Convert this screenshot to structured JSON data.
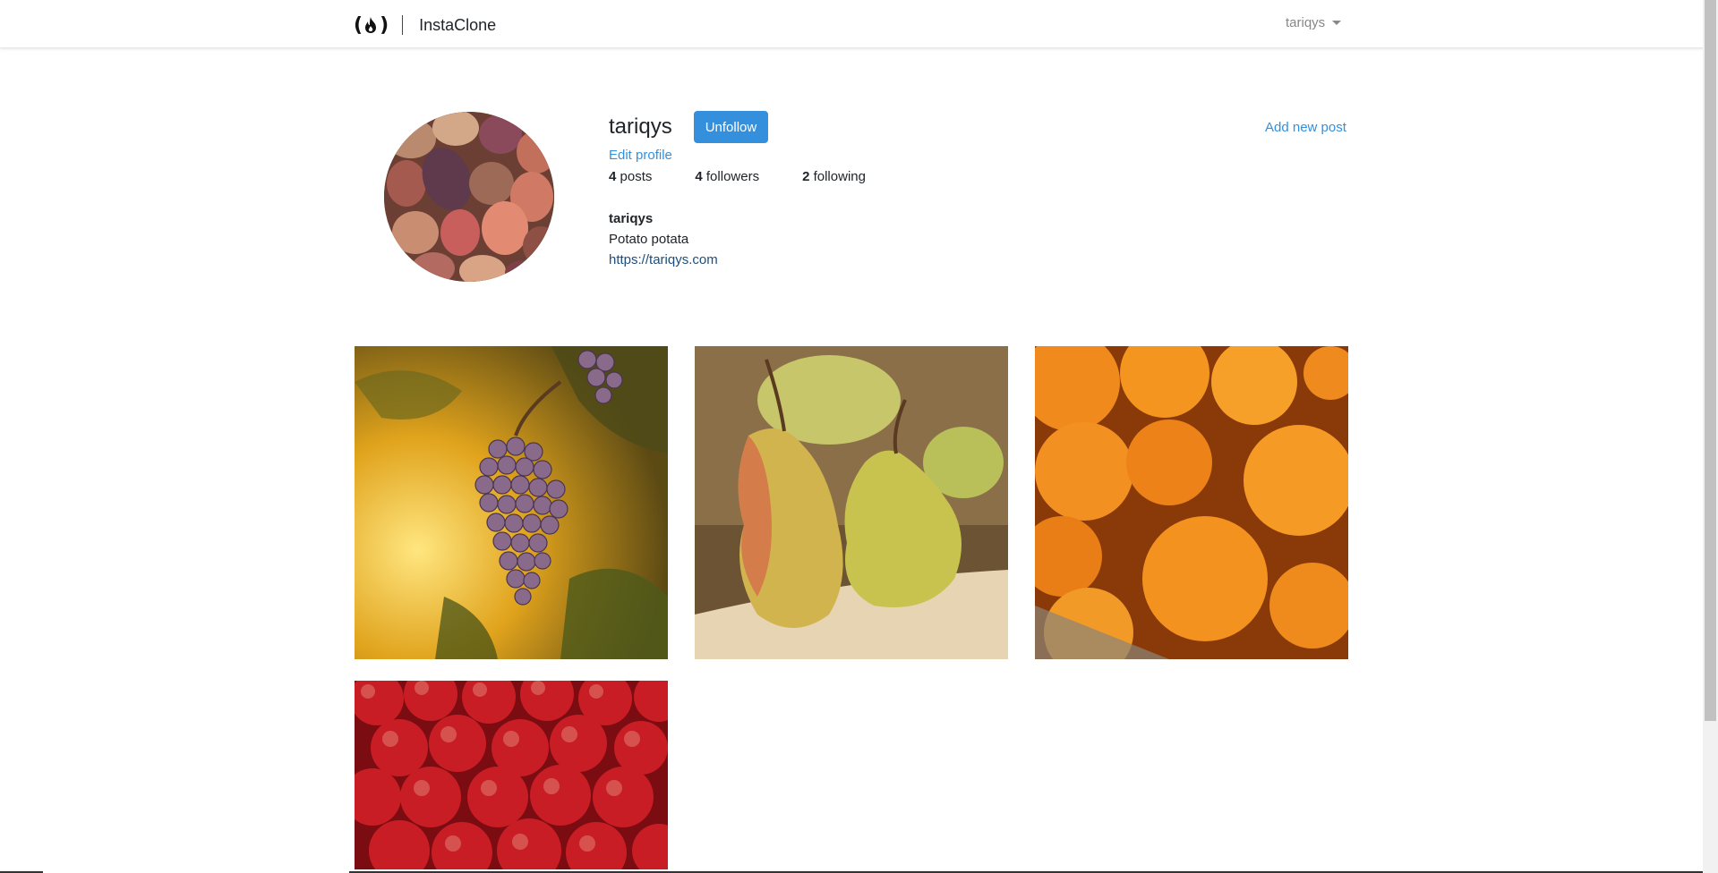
{
  "navbar": {
    "brand_name": "InstaClone",
    "user_menu_label": "tariqys"
  },
  "profile": {
    "username": "tariqys",
    "unfollow_label": "Unfollow",
    "edit_profile_label": "Edit profile",
    "add_post_label": "Add new post",
    "stats": {
      "posts_count": "4",
      "posts_label": "posts",
      "followers_count": "4",
      "followers_label": "followers",
      "following_count": "2",
      "following_label": "following"
    },
    "bio": {
      "title": "tariqys",
      "description": "Potato potata",
      "url": "https://tariqys.com"
    }
  },
  "posts": [
    {
      "subject": "grapes"
    },
    {
      "subject": "pears"
    },
    {
      "subject": "oranges"
    },
    {
      "subject": "apples"
    }
  ],
  "colors": {
    "accent": "#3490dc",
    "link_dark": "#1d4e7a"
  }
}
